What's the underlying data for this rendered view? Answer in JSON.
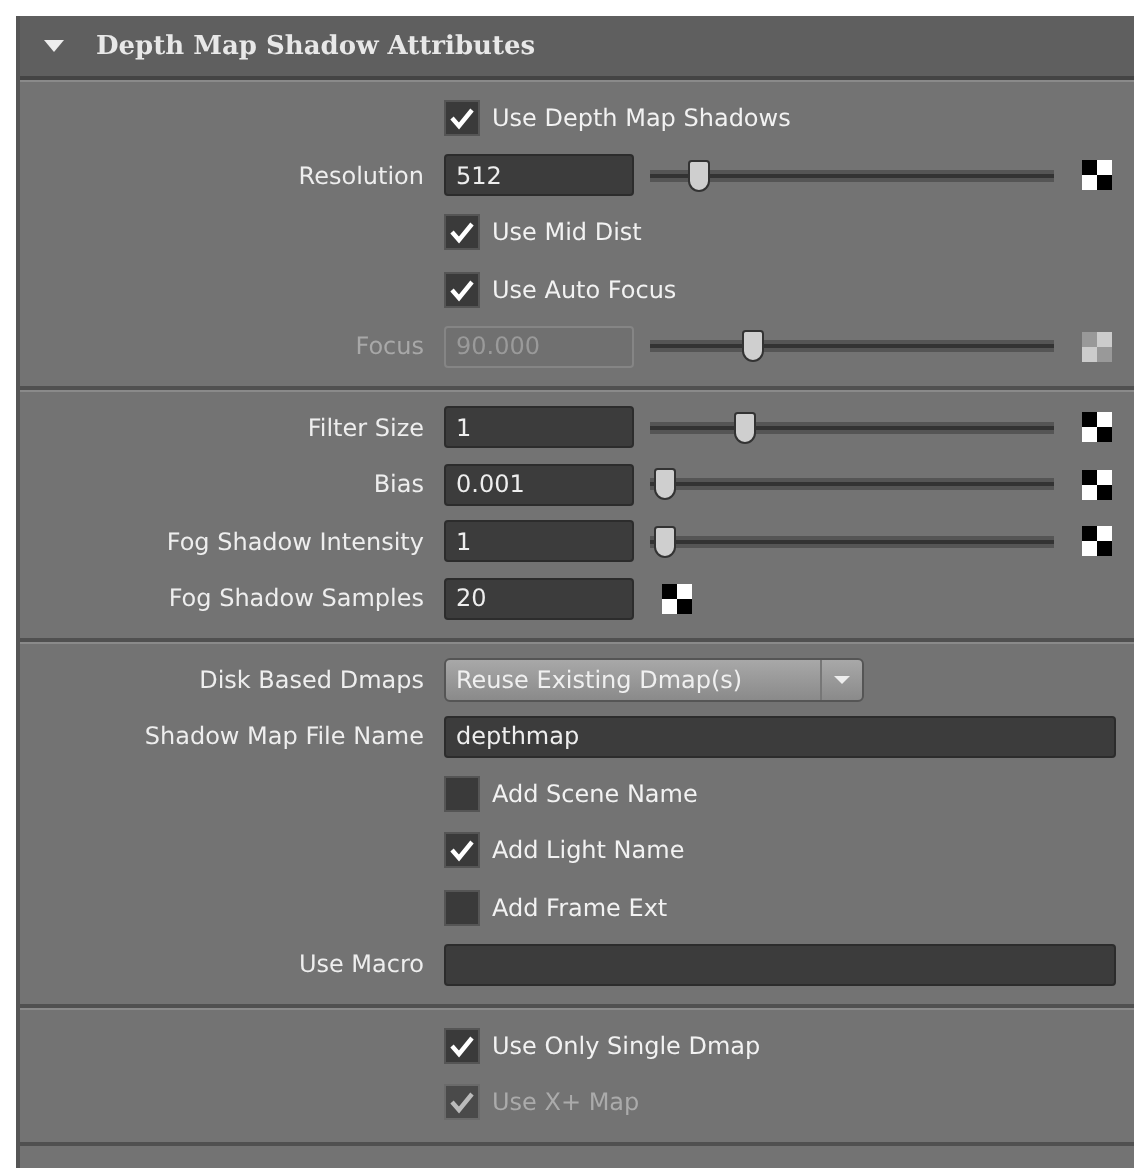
{
  "header": {
    "title": "Depth Map Shadow Attributes",
    "expanded": true
  },
  "sections": [
    [
      {
        "kind": "checkbox",
        "label": "Use Depth Map Shadows",
        "checked": true,
        "disabled": false
      },
      {
        "kind": "slider",
        "label": "Resolution",
        "value": "512",
        "level": 0.1,
        "disabled": false
      },
      {
        "kind": "checkbox",
        "label": "Use Mid Dist",
        "checked": true,
        "disabled": false
      },
      {
        "kind": "checkbox",
        "label": "Use Auto Focus",
        "checked": true,
        "disabled": false
      },
      {
        "kind": "slider",
        "label": "Focus",
        "value": "90.000",
        "level": 0.24,
        "disabled": true
      }
    ],
    [
      {
        "kind": "slider",
        "label": "Filter Size",
        "value": "1",
        "level": 0.22,
        "disabled": false
      },
      {
        "kind": "slider",
        "label": "Bias",
        "value": "0.001",
        "level": 0.01,
        "disabled": false
      },
      {
        "kind": "slider",
        "label": "Fog Shadow Intensity",
        "value": "1",
        "level": 0.01,
        "disabled": false
      },
      {
        "kind": "number",
        "label": "Fog Shadow Samples",
        "value": "20"
      }
    ],
    [
      {
        "kind": "dropdown",
        "label": "Disk Based Dmaps",
        "value": "Reuse Existing Dmap(s)"
      },
      {
        "kind": "text",
        "label": "Shadow Map File Name",
        "value": "depthmap"
      },
      {
        "kind": "checkbox",
        "label": "Add Scene Name",
        "checked": false,
        "disabled": false
      },
      {
        "kind": "checkbox",
        "label": "Add Light Name",
        "checked": true,
        "disabled": false
      },
      {
        "kind": "checkbox",
        "label": "Add Frame Ext",
        "checked": false,
        "disabled": false
      },
      {
        "kind": "text",
        "label": "Use Macro"
      }
    ],
    [
      {
        "kind": "checkbox",
        "label": "Use Only Single Dmap",
        "checked": true,
        "disabled": false
      },
      {
        "kind": "checkbox",
        "label": "Use X+ Map",
        "checked": true,
        "disabled": true
      }
    ]
  ]
}
